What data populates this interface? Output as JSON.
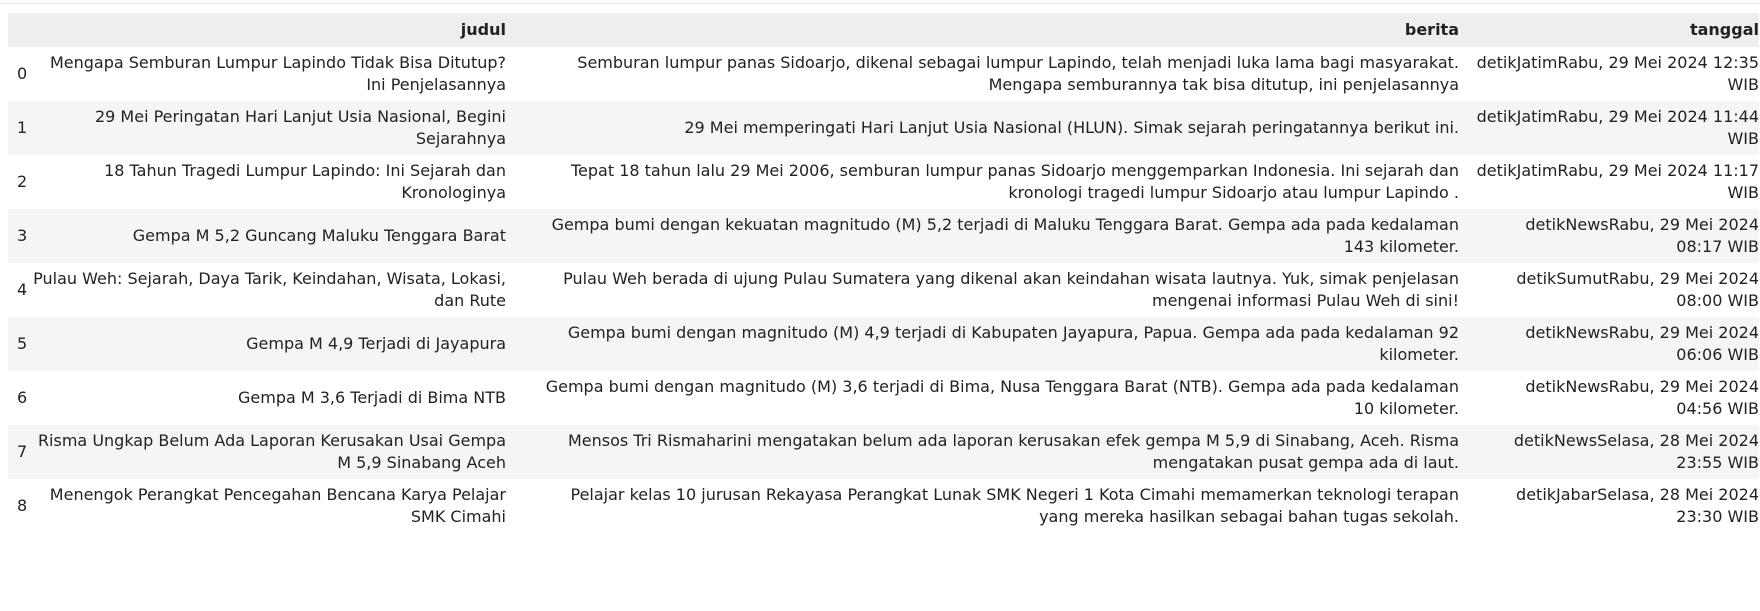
{
  "table": {
    "columns": {
      "index": "",
      "judul": "judul",
      "berita": "berita",
      "tanggal": "tanggal"
    },
    "rows": [
      {
        "index": "0",
        "judul": "Mengapa Semburan Lumpur Lapindo Tidak Bisa Ditutup? Ini Penjelasannya",
        "berita": "Semburan lumpur panas Sidoarjo, dikenal sebagai lumpur Lapindo, telah menjadi luka lama bagi masyarakat. Mengapa semburannya tak bisa ditutup, ini penjelasannya",
        "tanggal": "detikJatimRabu, 29 Mei 2024 12:35 WIB"
      },
      {
        "index": "1",
        "judul": "29 Mei Peringatan Hari Lanjut Usia Nasional, Begini Sejarahnya",
        "berita": "29 Mei memperingati Hari Lanjut Usia Nasional (HLUN). Simak sejarah peringatannya berikut ini.",
        "tanggal": "detikJatimRabu, 29 Mei 2024 11:44 WIB"
      },
      {
        "index": "2",
        "judul": "18 Tahun Tragedi Lumpur Lapindo: Ini Sejarah dan Kronologinya",
        "berita": "Tepat 18 tahun lalu 29 Mei 2006, semburan lumpur panas Sidoarjo menggemparkan Indonesia. Ini sejarah dan kronologi tragedi lumpur Sidoarjo atau lumpur Lapindo .",
        "tanggal": "detikJatimRabu, 29 Mei 2024 11:17 WIB"
      },
      {
        "index": "3",
        "judul": "Gempa M 5,2 Guncang Maluku Tenggara Barat",
        "berita": "Gempa bumi dengan kekuatan magnitudo (M) 5,2 terjadi di Maluku Tenggara Barat. Gempa ada pada kedalaman 143 kilometer.",
        "tanggal": "detikNewsRabu, 29 Mei 2024 08:17 WIB"
      },
      {
        "index": "4",
        "judul": "Pulau Weh: Sejarah, Daya Tarik, Keindahan, Wisata, Lokasi, dan Rute",
        "berita": "Pulau Weh berada di ujung Pulau Sumatera yang dikenal akan keindahan wisata lautnya. Yuk, simak penjelasan mengenai informasi Pulau Weh di sini!",
        "tanggal": "detikSumutRabu, 29 Mei 2024 08:00 WIB"
      },
      {
        "index": "5",
        "judul": "Gempa M 4,9 Terjadi di Jayapura",
        "berita": "Gempa bumi dengan magnitudo (M) 4,9 terjadi di Kabupaten Jayapura, Papua. Gempa ada pada kedalaman 92 kilometer.",
        "tanggal": "detikNewsRabu, 29 Mei 2024 06:06 WIB"
      },
      {
        "index": "6",
        "judul": "Gempa M 3,6 Terjadi di Bima NTB",
        "berita": "Gempa bumi dengan magnitudo (M) 3,6 terjadi di Bima, Nusa Tenggara Barat (NTB). Gempa ada pada kedalaman 10 kilometer.",
        "tanggal": "detikNewsRabu, 29 Mei 2024 04:56 WIB"
      },
      {
        "index": "7",
        "judul": "Risma Ungkap Belum Ada Laporan Kerusakan Usai Gempa M 5,9 Sinabang Aceh",
        "berita": "Mensos Tri Rismaharini mengatakan belum ada laporan kerusakan efek gempa M 5,9 di Sinabang, Aceh. Risma mengatakan pusat gempa ada di laut.",
        "tanggal": "detikNewsSelasa, 28 Mei 2024 23:55 WIB"
      },
      {
        "index": "8",
        "judul": "Menengok Perangkat Pencegahan Bencana Karya Pelajar SMK Cimahi",
        "berita": "Pelajar kelas 10 jurusan Rekayasa Perangkat Lunak SMK Negeri 1 Kota Cimahi memamerkan teknologi terapan yang mereka hasilkan sebagai bahan tugas sekolah.",
        "tanggal": "detikJabarSelasa, 28 Mei 2024 23:30 WIB"
      }
    ]
  }
}
